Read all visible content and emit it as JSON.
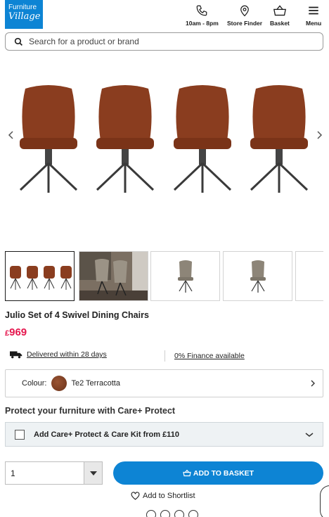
{
  "header": {
    "logo_line1": "Furniture",
    "logo_line2": "Village",
    "hours_label": "10am - 8pm",
    "store_finder_label": "Store Finder",
    "basket_label": "Basket",
    "menu_label": "Menu"
  },
  "search": {
    "placeholder": "Search for a product or brand"
  },
  "product": {
    "title": "Julio Set of 4 Swivel Dining Chairs",
    "currency": "£",
    "price": "969",
    "delivery_text": "Delivered within 28 days",
    "finance_text": "0% Finance available",
    "colour_label": "Colour:",
    "colour_value": "Te2 Terracotta"
  },
  "care": {
    "heading": "Protect your furniture with Care+ Protect",
    "option_label": "Add Care+ Protect & Care Kit from £110"
  },
  "purchase": {
    "quantity": "1",
    "add_to_basket_label": "ADD TO BASKET",
    "shortlist_label": "Add to Shortlist"
  },
  "colors": {
    "brand_blue": "#0d84d4",
    "price_pink": "#e5174e",
    "chair_fabric": "#8a3d1f"
  }
}
